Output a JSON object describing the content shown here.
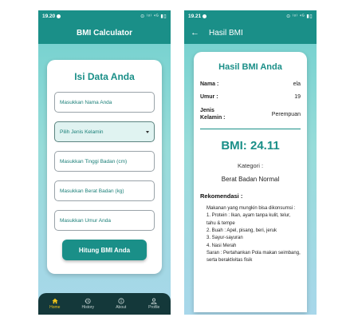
{
  "left": {
    "status": {
      "time": "19.20",
      "icons": "⊙ ⁽ᵒ⁾ ⁴ᴳ ▮▯"
    },
    "appbar": {
      "title": "BMI Calculator"
    },
    "form": {
      "title": "Isi Data Anda",
      "name_placeholder": "Masukkan Nama Anda",
      "gender_placeholder": "Pilih Jenis Kelamin",
      "height_placeholder": "Masukkan Tinggi Badan (cm)",
      "weight_placeholder": "Masukkan Berat Badan (kg)",
      "age_placeholder": "Masukkan Umur Anda",
      "button": "Hitung BMI Anda"
    },
    "nav": {
      "home": "Home",
      "history": "History",
      "about": "About",
      "profile": "Profile"
    }
  },
  "right": {
    "status": {
      "time": "19.21",
      "icons": "⊙ ⁽ᵒ⁾ ⁴ᴳ ▮▯"
    },
    "appbar": {
      "title": "Hasil BMI"
    },
    "result": {
      "title": "Hasil BMI Anda",
      "name_label": "Nama :",
      "name_value": "ela",
      "age_label": "Umur :",
      "age_value": "19",
      "gender_label": "Jenis Kelamin :",
      "gender_value": "Perempuan",
      "bmi": "BMI: 24.11",
      "category_label": "Kategori :",
      "category_value": "Berat Badan Normal",
      "recommendation_title": "Rekomendasi :",
      "recommendation_text": "Makanan yang mungkin bisa dikonsumsi :\n1. Protein : Ikan, ayam tanpa kulit, telur, tahu & tempe\n2. Buah : Apel, pisang, beri, jeruk\n3. Sayur-sayuran\n4. Nasi Merah\nSaran : Pertahankan Pola makan seimbang, serta beraktivitas fisik"
    }
  }
}
